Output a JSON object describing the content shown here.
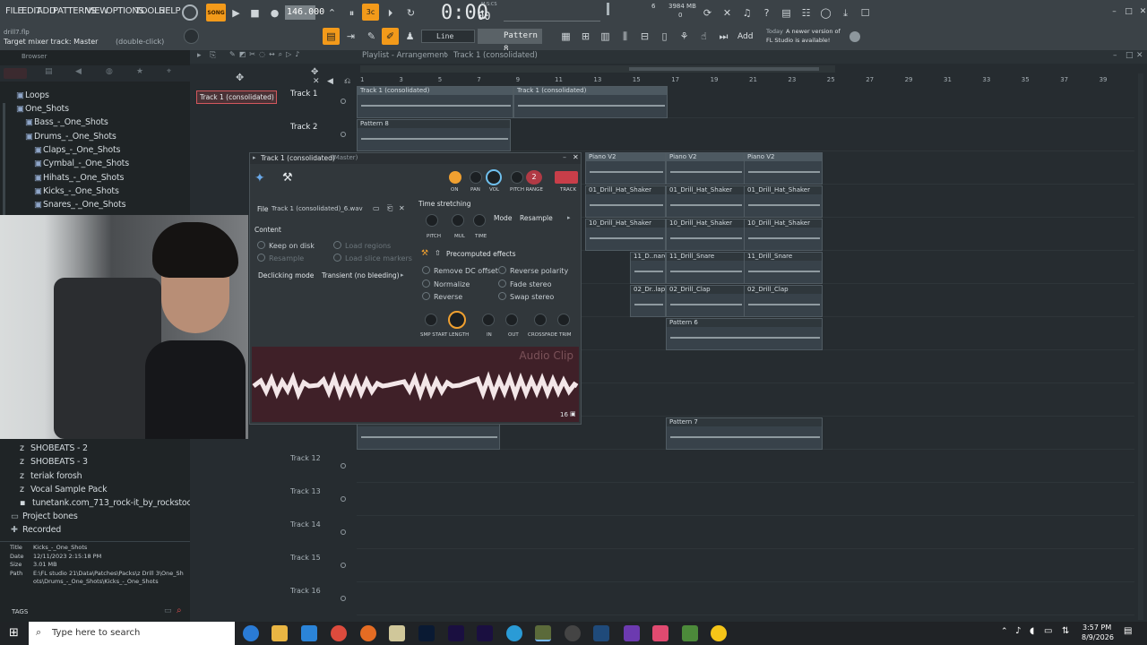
{
  "menu": [
    "FILE",
    "EDIT",
    "ADD",
    "PATTERNS",
    "VIEW",
    "OPTIONS",
    "TOOLS",
    "HELP"
  ],
  "project": {
    "file": "drill7.flp",
    "hint": "Target mixer track: Master",
    "hint_action": "(double-click)"
  },
  "transport": {
    "song_label": "SONG",
    "tempo": "146.000",
    "time": "0:00",
    "time_sub": "00",
    "time_label": "M:S:CS",
    "cpu": "6",
    "mem": "3984 MB",
    "voices": "0"
  },
  "toolbar": {
    "snap": "Line",
    "pattern": "Pattern 8",
    "add": "Add",
    "news_title": "Today",
    "news_body": "A newer version of",
    "news_body2": "FL Studio is available!"
  },
  "browser": {
    "title": "Browser",
    "items": [
      {
        "label": "Loops",
        "indent": 1
      },
      {
        "label": "One_Shots",
        "indent": 1
      },
      {
        "label": "Bass_-_One_Shots",
        "indent": 2
      },
      {
        "label": "Drums_-_One_Shots",
        "indent": 2
      },
      {
        "label": "Claps_-_One_Shots",
        "indent": 3
      },
      {
        "label": "Cymbal_-_One_Shots",
        "indent": 3
      },
      {
        "label": "Hihats_-_One_Shots",
        "indent": 3
      },
      {
        "label": "Kicks_-_One_Shots",
        "indent": 3
      },
      {
        "label": "Snares_-_One_Shots",
        "indent": 3
      }
    ],
    "lower": [
      "SHOBEATS - 2",
      "SHOBEATS - 3",
      "teriak forosh",
      "Vocal Sample Pack",
      "tunetank.com_713_rock-it_by_rockstock",
      "Project bones",
      "Recorded"
    ],
    "info": {
      "title_label": "Title",
      "title": "Kicks_-_One_Shots",
      "date_label": "Date",
      "date": "12/11/2023 2:15:18 PM",
      "size_label": "Size",
      "size": "3.01 MB",
      "path_label": "Path",
      "path": "E:\\FL studio 21\\Data\\Patches\\Packs\\z Drill 3\\One_Shots\\Drums_-_One_Shots\\Kicks_-_One_Shots"
    },
    "tags": "TAGS"
  },
  "playlist": {
    "title": "Playlist - Arrangement",
    "crumb": "Track 1 (consolidated)",
    "selected_clip": "Track 1 (consolidated)",
    "tracks": [
      "Track 1",
      "Track 2",
      "Track 12",
      "Track 13",
      "Track 14",
      "Track 15",
      "Track 16"
    ],
    "ruler": [
      "1",
      "3",
      "5",
      "7",
      "9",
      "11",
      "13",
      "15",
      "17",
      "19",
      "21",
      "23",
      "25",
      "27",
      "29",
      "31",
      "33",
      "35",
      "37",
      "39"
    ],
    "clips": {
      "t1a": "Track 1 (consolidated)",
      "t1b": "Track 1 (consolidated)",
      "p8": "Pattern 8",
      "piano": "Piano V2",
      "hat1": "01_Drill_Hat_Shaker",
      "hat2": "10_Drill_Hat_Shaker",
      "sn1": "11_D..nare",
      "sn2": "11_Drill_Snare",
      "clap1": "02_Dr..lap",
      "clap2": "02_Drill_Clap",
      "p6": "Pattern 6",
      "p7": "Pattern 7"
    }
  },
  "sampler": {
    "title": "Track 1 (consolidated)",
    "title_target": "(Master)",
    "file_label": "File",
    "file": "Track 1 (consolidated)_6.wav",
    "content_label": "Content",
    "keep_on_disk": "Keep on disk",
    "resample": "Resample",
    "load_regions": "Load regions",
    "load_slice": "Load slice markers",
    "declick_label": "Declicking mode",
    "declick": "Transient (no bleeding)",
    "ts_label": "Time stretching",
    "mode_label": "Mode",
    "mode": "Resample",
    "ts_knobs": [
      "PITCH",
      "MUL",
      "TIME"
    ],
    "top_knobs": [
      "ON",
      "PAN",
      "VOL",
      "PITCH RANGE",
      "TRACK"
    ],
    "range": "2",
    "precomputed": "Precomputed effects",
    "effects": [
      "Remove DC offset",
      "Normalize",
      "Reverse",
      "Reverse polarity",
      "Fade stereo",
      "Swap stereo"
    ],
    "bottom_knobs": [
      "SMP START",
      "LENGTH",
      "IN",
      "OUT",
      "CROSSFADE",
      "TRIM"
    ],
    "wave_label": "Audio Clip",
    "bits": "16"
  },
  "taskbar": {
    "search": "Type here to search",
    "time": "3:57 PM",
    "date": "8/9/2026"
  }
}
